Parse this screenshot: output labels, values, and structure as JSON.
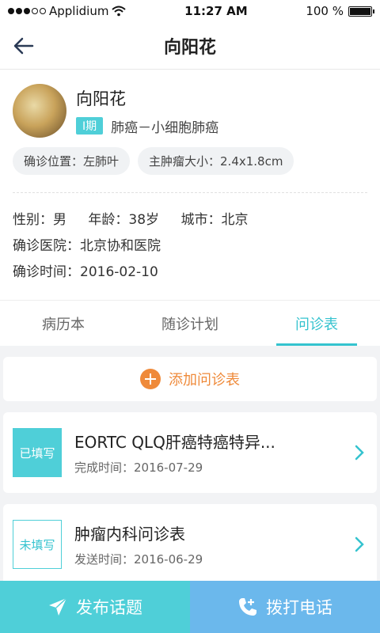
{
  "status_bar": {
    "carrier": "Applidium",
    "time": "11:27 AM",
    "battery": "100 %",
    "battery_level": 1.0
  },
  "nav": {
    "title": "向阳花"
  },
  "patient": {
    "name": "向阳花",
    "stage": "I期",
    "diagnosis": "肺癌－小细胞肺癌",
    "chips": [
      "确诊位置：左肺叶",
      "主肿瘤大小：2.4x1.8cm"
    ],
    "gender": "性别：男",
    "age": "年龄：38岁",
    "city": "城市：北京",
    "hospital": "确诊医院：北京协和医院",
    "diagnosis_time": "确诊时间：2016-02-10"
  },
  "tabs": [
    {
      "label": "病历本",
      "active": false
    },
    {
      "label": "随诊计划",
      "active": false
    },
    {
      "label": "问诊表",
      "active": true
    }
  ],
  "add_questionnaire": {
    "label": "添加问诊表"
  },
  "questionnaires": [
    {
      "status": "已填写",
      "title": "EORTC QLQ肝癌特癌特异...",
      "time": "完成时间：2016-07-29"
    },
    {
      "status": "未填写",
      "title": "肿瘤内科问诊表",
      "time": "发送时间：2016-06-29"
    }
  ],
  "bottom": {
    "post_label": "发布话题",
    "call_label": "拨打电话"
  },
  "colors": {
    "accent": "#4fcfd8",
    "orange": "#ef8a3a",
    "call_blue": "#6bb8ec"
  }
}
